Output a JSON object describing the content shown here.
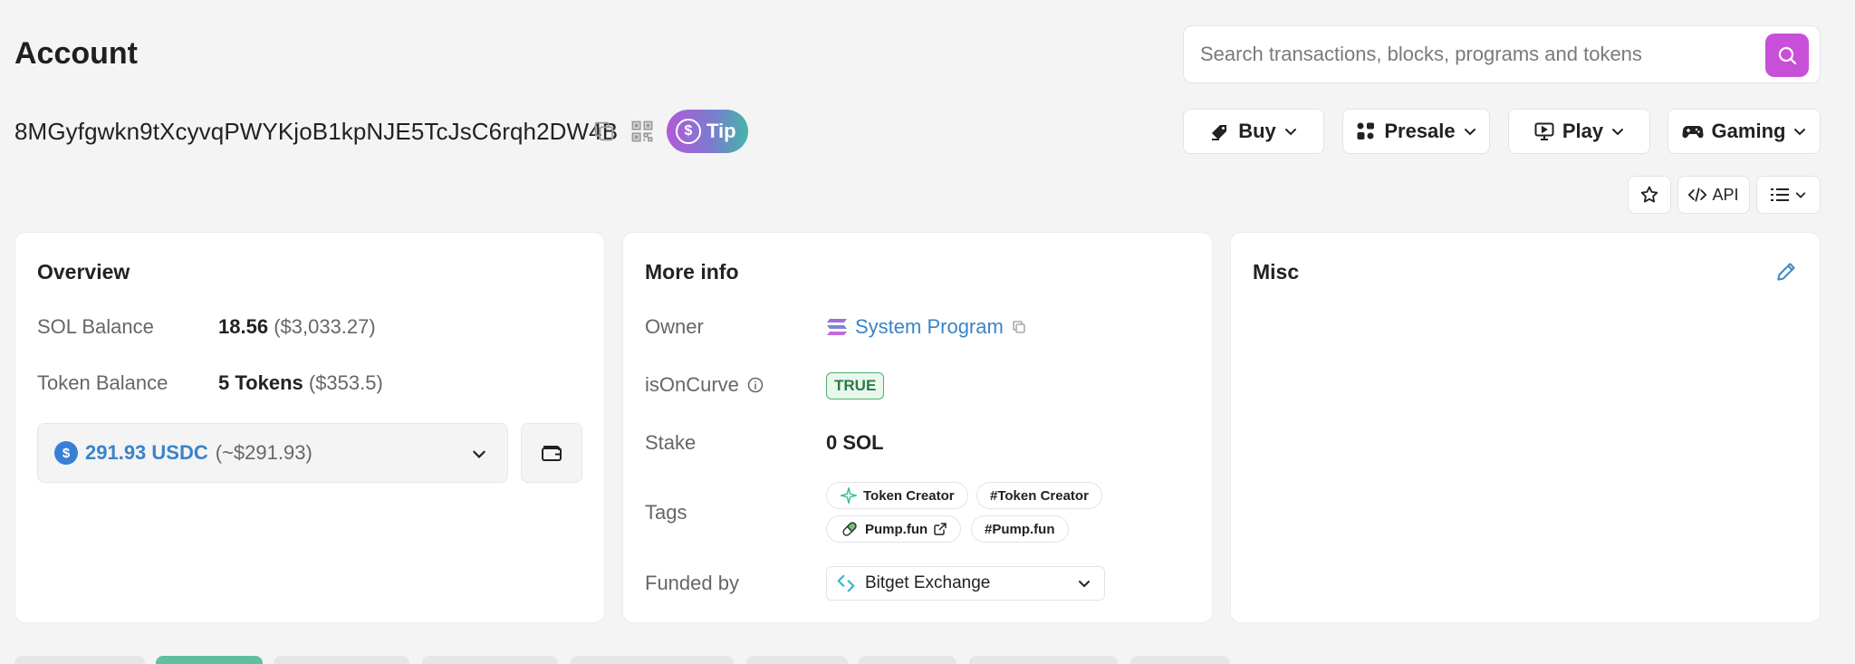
{
  "header": {
    "title": "Account",
    "search_placeholder": "Search transactions, blocks, programs and tokens",
    "search_value": ""
  },
  "account": {
    "address": "8MGyfgwkn9tXcyvqPWYKjoB1kpNJE5TcJsC6rqh2DW4B",
    "tip_label": "Tip"
  },
  "menus": [
    {
      "label": "Buy",
      "icon": "tag-icon"
    },
    {
      "label": "Presale",
      "icon": "presale-icon"
    },
    {
      "label": "Play",
      "icon": "monitor-play-icon"
    },
    {
      "label": "Gaming",
      "icon": "gamepad-icon"
    }
  ],
  "toolbar": {
    "api_label": "API"
  },
  "overview": {
    "title": "Overview",
    "sol_balance_label": "SOL Balance",
    "sol_balance_value": "18.56",
    "sol_balance_usd": "($3,033.27)",
    "token_balance_label": "Token Balance",
    "token_balance_value": "5 Tokens",
    "token_balance_usd": "($353.5)",
    "selected_token_amount": "291.93 USDC",
    "selected_token_usd": "(~$291.93)"
  },
  "more_info": {
    "title": "More info",
    "owner_label": "Owner",
    "owner_value": "System Program",
    "is_on_curve_label": "isOnCurve",
    "is_on_curve_value": "TRUE",
    "stake_label": "Stake",
    "stake_value": "0 SOL",
    "tags_label": "Tags",
    "tags": [
      "Token Creator",
      "#Token Creator",
      "Pump.fun",
      "#Pump.fun"
    ],
    "funded_by_label": "Funded by",
    "funded_by_value": "Bitget Exchange"
  },
  "misc": {
    "title": "Misc"
  },
  "colors": {
    "accent_purple": "#c84fd8",
    "link_blue": "#3a83c9",
    "badge_green": "#4caf6a",
    "active_tab_green": "#5fbf9f"
  }
}
